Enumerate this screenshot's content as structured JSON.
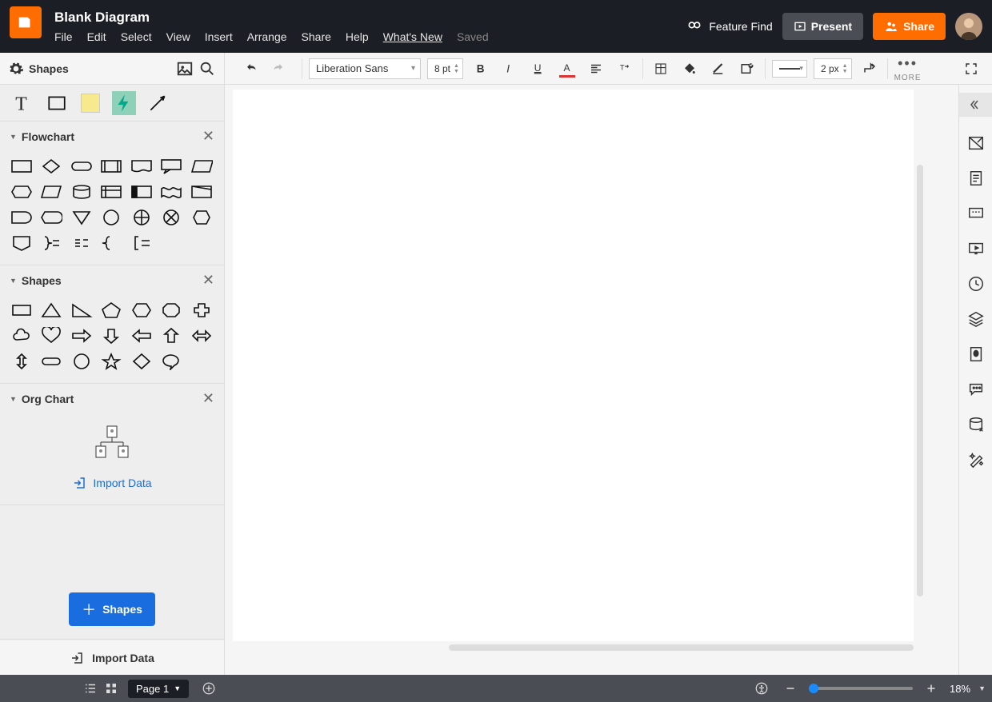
{
  "header": {
    "title": "Blank Diagram",
    "menu": [
      "File",
      "Edit",
      "Select",
      "View",
      "Insert",
      "Arrange",
      "Share",
      "Help"
    ],
    "whats_new": "What's New",
    "saved": "Saved",
    "feature_find": "Feature Find",
    "present": "Present",
    "share": "Share"
  },
  "toolbar": {
    "shapes_label": "Shapes",
    "font": "Liberation Sans",
    "font_size": "8 pt",
    "line_width": "2 px",
    "more": "MORE"
  },
  "quickshapes": [
    "text",
    "rect",
    "note",
    "action",
    "arrow"
  ],
  "panels": {
    "flowchart": {
      "title": "Flowchart"
    },
    "shapes": {
      "title": "Shapes"
    },
    "orgchart": {
      "title": "Org Chart",
      "import": "Import Data"
    }
  },
  "sidebar": {
    "shapes_button": "Shapes",
    "import_data": "Import Data"
  },
  "footer": {
    "page_label": "Page 1",
    "zoom": "18%"
  },
  "right_rail_icons": [
    "select",
    "notes",
    "comments-panel",
    "slideshow",
    "history",
    "layers",
    "theme",
    "chat",
    "data",
    "magic"
  ]
}
